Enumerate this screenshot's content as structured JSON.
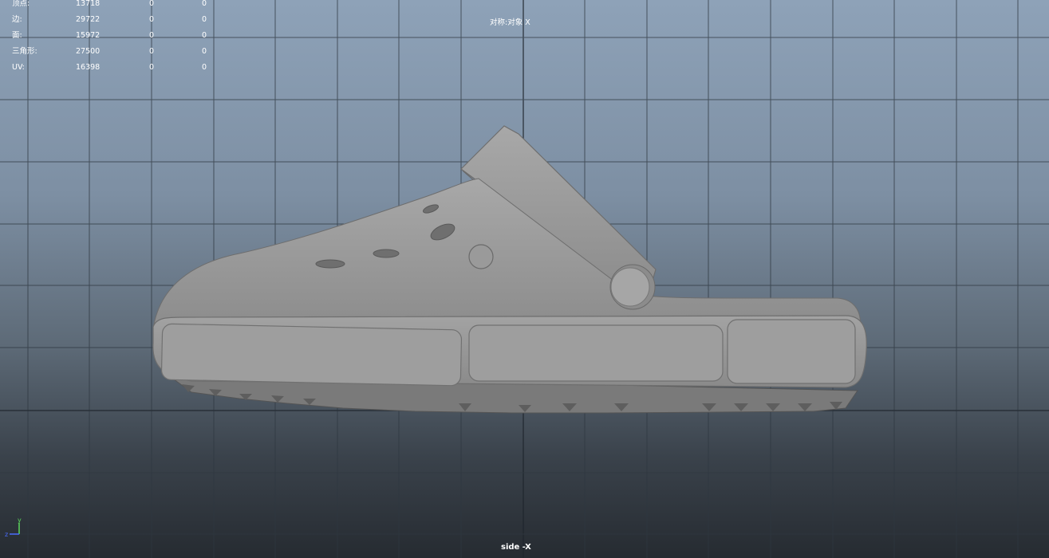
{
  "hud": {
    "rows": [
      {
        "label": "顶点:",
        "value": "13718",
        "selected": "0",
        "triangles": "0"
      },
      {
        "label": "边:",
        "value": "29722",
        "selected": "0",
        "triangles": "0"
      },
      {
        "label": "面:",
        "value": "15972",
        "selected": "0",
        "triangles": "0"
      },
      {
        "label": "三角形:",
        "value": "27500",
        "selected": "0",
        "triangles": "0"
      },
      {
        "label": "UV:",
        "value": "16398",
        "selected": "0",
        "triangles": "0"
      }
    ]
  },
  "viewport": {
    "symmetry_label": "对称:对象 X",
    "camera_label": "side -X",
    "axis_y": "y",
    "axis_z": "z",
    "colors": {
      "bg_top": "#8ea2b8",
      "bg_bottom": "#262b31",
      "grid_line": "#2e3740",
      "model": "#9a9a9a",
      "axis_y": "#5cd85c",
      "axis_z": "#4a6cff"
    }
  },
  "model": {
    "name_icon": "clog-shoe-mesh"
  }
}
